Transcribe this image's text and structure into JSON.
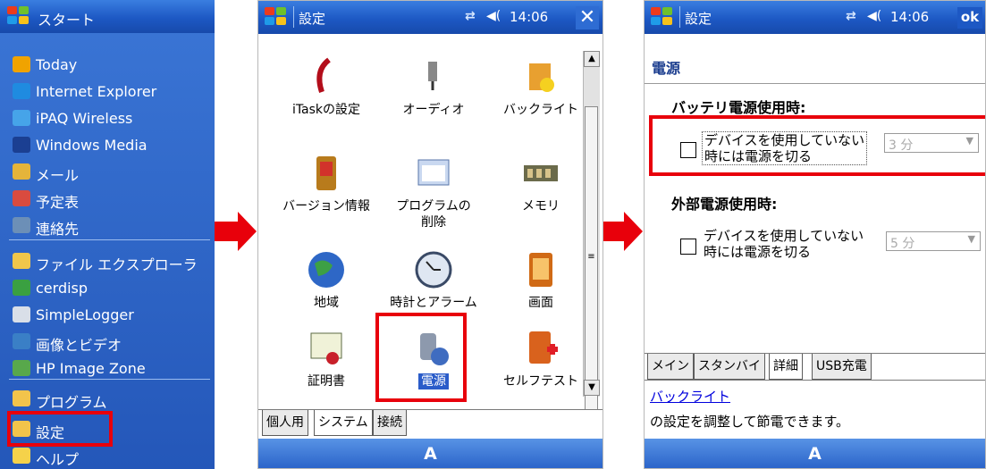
{
  "start_menu": {
    "title": "スタート",
    "items": [
      {
        "label": "Today",
        "icon": "today-icon",
        "color": "#f0a300"
      },
      {
        "label": "Internet Explorer",
        "icon": "internet-explorer-icon",
        "color": "#1f8be0"
      },
      {
        "label": "iPAQ Wireless",
        "icon": "ipaq-wireless-icon",
        "color": "#46a4e9"
      },
      {
        "label": "Windows Media",
        "icon": "windows-media-icon",
        "color": "#1b3f92"
      },
      {
        "label": "メール",
        "icon": "mail-icon",
        "color": "#e5b43a"
      },
      {
        "label": "予定表",
        "icon": "calendar-icon",
        "color": "#d94b3f"
      },
      {
        "label": "連絡先",
        "icon": "contacts-icon",
        "color": "#6c8fb7"
      },
      {
        "label": "ファイル エクスプローラ",
        "icon": "file-explorer-icon",
        "color": "#f0c64a"
      },
      {
        "label": "cerdisp",
        "icon": "cerdisp-icon",
        "color": "#3aa041"
      },
      {
        "label": "SimpleLogger",
        "icon": "simplelogger-icon",
        "color": "#d9dfe8"
      },
      {
        "label": "画像とビデオ",
        "icon": "pictures-video-icon",
        "color": "#3a7fc6"
      },
      {
        "label": "HP Image Zone",
        "icon": "hp-image-zone-icon",
        "color": "#58a84b"
      },
      {
        "label": "プログラム",
        "icon": "programs-folder-icon",
        "color": "#f2c44b"
      },
      {
        "label": "設定",
        "icon": "settings-folder-icon",
        "color": "#f2c44b"
      },
      {
        "label": "ヘルプ",
        "icon": "help-icon",
        "color": "#f5d24a"
      }
    ]
  },
  "settings_screen": {
    "title": "設定",
    "clock": "14:06",
    "close_label": "✕",
    "icons": [
      {
        "label": "iTaskの設定",
        "icon": "itask-icon"
      },
      {
        "label": "オーディオ",
        "icon": "audio-icon"
      },
      {
        "label": "バックライト",
        "icon": "backlight-icon"
      },
      {
        "label": "バージョン情報",
        "icon": "version-info-icon"
      },
      {
        "label": "プログラムの削除",
        "icon": "remove-programs-icon"
      },
      {
        "label": "メモリ",
        "icon": "memory-icon"
      },
      {
        "label": "地域",
        "icon": "region-icon"
      },
      {
        "label": "時計とアラーム",
        "icon": "clock-alarm-icon"
      },
      {
        "label": "画面",
        "icon": "screen-icon"
      },
      {
        "label": "証明書",
        "icon": "certificate-icon"
      },
      {
        "label": "電源",
        "icon": "power-icon"
      },
      {
        "label": "セルフテスト",
        "icon": "self-test-icon"
      }
    ],
    "tabs": [
      "個人用",
      "システム",
      "接続"
    ],
    "active_tab": "システム",
    "input_label": "A"
  },
  "power_screen": {
    "title": "設定",
    "clock": "14:06",
    "ok_label": "ok",
    "page_title": "電源",
    "battery_section": "バッテリ電源使用時:",
    "battery_checkbox_line1": "デバイスを使用していない",
    "battery_checkbox_line2": "時には電源を切る",
    "battery_timeout": "3 分",
    "external_section": "外部電源使用時:",
    "external_checkbox_line1": "デバイスを使用していない",
    "external_checkbox_line2": "時には電源を切る",
    "external_timeout": "5 分",
    "tabs": [
      "メイン",
      "スタンバイ",
      "詳細",
      "USB充電"
    ],
    "active_tab": "詳細",
    "link_text": "バックライト",
    "info_text": "の設定を調整して節電できます。",
    "input_label": "A"
  },
  "colors": {
    "highlight_red": "#e8000b",
    "title_blue": "#1d58c4"
  }
}
